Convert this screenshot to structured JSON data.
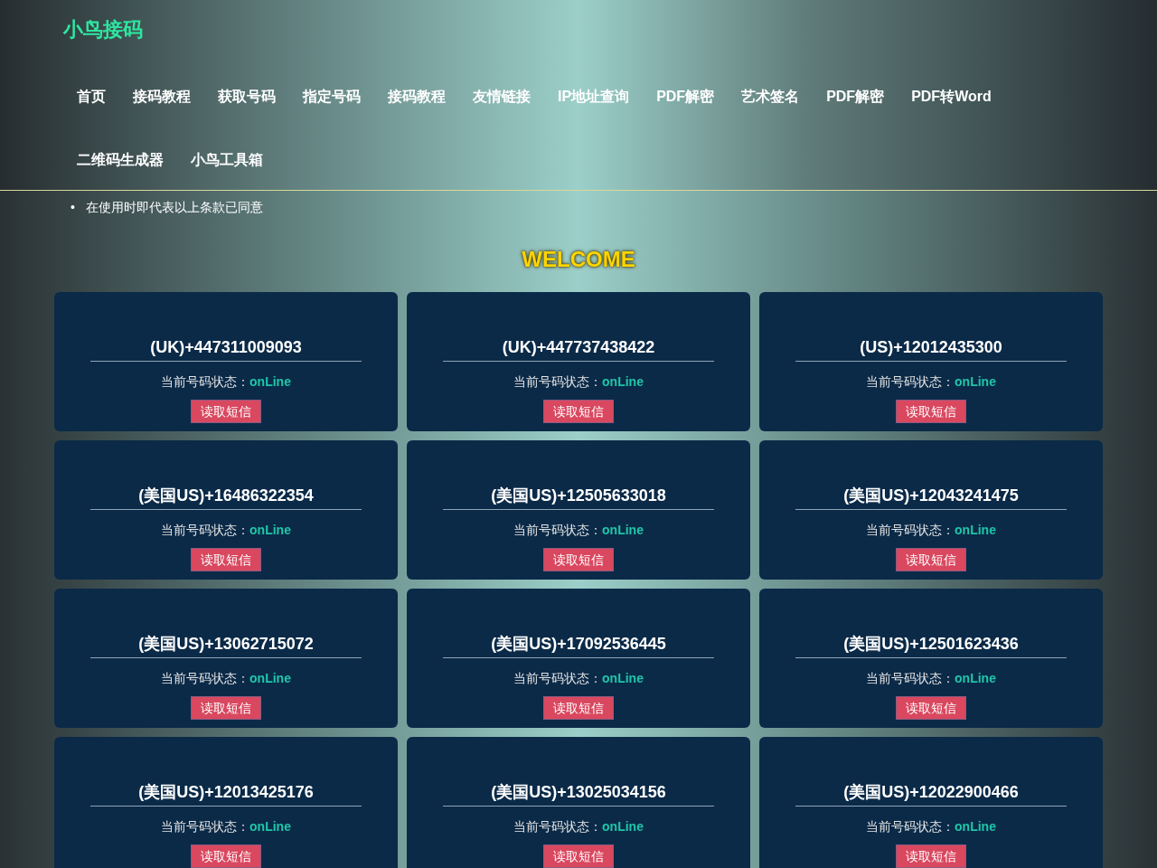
{
  "header": {
    "logo": "小鸟接码",
    "nav": [
      {
        "label": "首页"
      },
      {
        "label": "接码教程"
      },
      {
        "label": "获取号码"
      },
      {
        "label": "指定号码"
      },
      {
        "label": "接码教程"
      },
      {
        "label": "友情链接"
      },
      {
        "label": "IP地址查询"
      },
      {
        "label": "PDF解密"
      },
      {
        "label": "艺术签名"
      },
      {
        "label": "PDF解密"
      },
      {
        "label": "PDF转Word"
      },
      {
        "label": "二维码生成器"
      },
      {
        "label": "小鸟工具箱"
      }
    ]
  },
  "notice": [
    {
      "bullet": "•",
      "text": "在使用时即代表以上条款已同意"
    }
  ],
  "welcome": "WELCOME",
  "numbers": [
    {
      "number": "(UK)+447311009093",
      "status_label": "当前号码状态：",
      "status": "onLine",
      "button": "读取短信"
    },
    {
      "number": "(UK)+447737438422",
      "status_label": "当前号码状态：",
      "status": "onLine",
      "button": "读取短信"
    },
    {
      "number": "(US)+12012435300",
      "status_label": "当前号码状态：",
      "status": "onLine",
      "button": "读取短信"
    },
    {
      "number": "(美国US)+16486322354",
      "status_label": "当前号码状态：",
      "status": "onLine",
      "button": "读取短信"
    },
    {
      "number": "(美国US)+12505633018",
      "status_label": "当前号码状态：",
      "status": "onLine",
      "button": "读取短信"
    },
    {
      "number": "(美国US)+12043241475",
      "status_label": "当前号码状态：",
      "status": "onLine",
      "button": "读取短信"
    },
    {
      "number": "(美国US)+13062715072",
      "status_label": "当前号码状态：",
      "status": "onLine",
      "button": "读取短信"
    },
    {
      "number": "(美国US)+17092536445",
      "status_label": "当前号码状态：",
      "status": "onLine",
      "button": "读取短信"
    },
    {
      "number": "(美国US)+12501623436",
      "status_label": "当前号码状态：",
      "status": "onLine",
      "button": "读取短信"
    },
    {
      "number": "(美国US)+12013425176",
      "status_label": "当前号码状态：",
      "status": "onLine",
      "button": "读取短信"
    },
    {
      "number": "(美国US)+13025034156",
      "status_label": "当前号码状态：",
      "status": "onLine",
      "button": "读取短信"
    },
    {
      "number": "(美国US)+12022900466",
      "status_label": "当前号码状态：",
      "status": "onLine",
      "button": "读取短信"
    }
  ]
}
